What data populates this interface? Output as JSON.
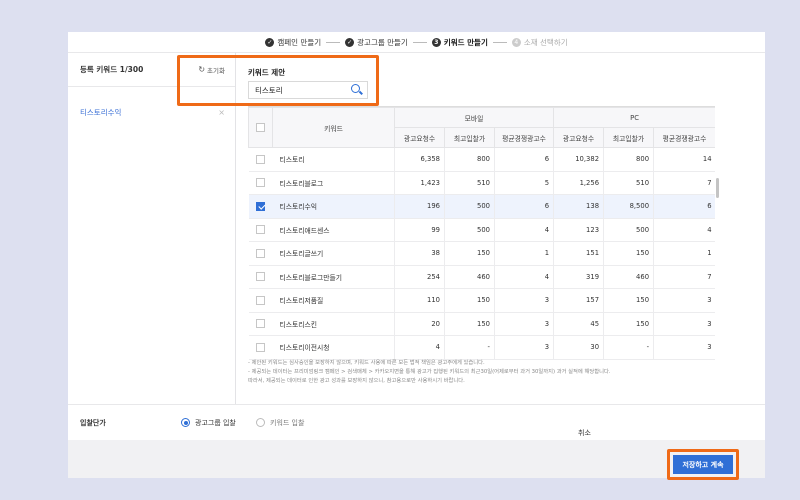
{
  "stepper": {
    "steps": [
      {
        "num": "✓",
        "label": "캠페인 만들기"
      },
      {
        "num": "✓",
        "label": "광고그룹 만들기"
      },
      {
        "num": "3",
        "label": "키워드 만들기"
      },
      {
        "num": "4",
        "label": "소재 선택하기"
      }
    ]
  },
  "left": {
    "title": "등록 키워드 1/300",
    "reset_label": "초기화",
    "items": [
      {
        "label": "티스토리수익",
        "remove": "×"
      }
    ]
  },
  "suggest": {
    "title": "키워드 제안",
    "search_value": "티스토리"
  },
  "table": {
    "col_keyword": "키워드",
    "group_mobile": "모바일",
    "group_pc": "PC",
    "sub_headers": [
      "광고요청수",
      "최고입찰가",
      "평균경쟁광고수",
      "광고요청수",
      "최고입찰가",
      "평균경쟁광고수"
    ],
    "rows": [
      {
        "checked": false,
        "keyword": "티스토리",
        "m_req": "6,358",
        "m_bid": "800",
        "m_comp": "6",
        "p_req": "10,382",
        "p_bid": "800",
        "p_comp": "14"
      },
      {
        "checked": false,
        "keyword": "티스토리블로그",
        "m_req": "1,423",
        "m_bid": "510",
        "m_comp": "5",
        "p_req": "1,256",
        "p_bid": "510",
        "p_comp": "7"
      },
      {
        "checked": true,
        "keyword": "티스토리수익",
        "m_req": "196",
        "m_bid": "500",
        "m_comp": "6",
        "p_req": "138",
        "p_bid": "8,500",
        "p_comp": "6"
      },
      {
        "checked": false,
        "keyword": "티스토리애드센스",
        "m_req": "99",
        "m_bid": "500",
        "m_comp": "4",
        "p_req": "123",
        "p_bid": "500",
        "p_comp": "4"
      },
      {
        "checked": false,
        "keyword": "티스토리글쓰기",
        "m_req": "38",
        "m_bid": "150",
        "m_comp": "1",
        "p_req": "151",
        "p_bid": "150",
        "p_comp": "1"
      },
      {
        "checked": false,
        "keyword": "티스토리블로그만들기",
        "m_req": "254",
        "m_bid": "460",
        "m_comp": "4",
        "p_req": "319",
        "p_bid": "460",
        "p_comp": "7"
      },
      {
        "checked": false,
        "keyword": "티스토리저품질",
        "m_req": "110",
        "m_bid": "150",
        "m_comp": "3",
        "p_req": "157",
        "p_bid": "150",
        "p_comp": "3"
      },
      {
        "checked": false,
        "keyword": "티스토리스킨",
        "m_req": "20",
        "m_bid": "150",
        "m_comp": "3",
        "p_req": "45",
        "p_bid": "150",
        "p_comp": "3"
      },
      {
        "checked": false,
        "keyword": "티스토리이전시청",
        "m_req": "4",
        "m_bid": "-",
        "m_comp": "3",
        "p_req": "30",
        "p_bid": "-",
        "p_comp": "3"
      }
    ]
  },
  "notes": [
    "- 제안된 키워드는 심사승인을 보장하지 않으며, 키워드 사용에 따른 모든 법적 책임은 광고주에게 있습니다.",
    "- 제공되는 데이터는 프리미엄링크 캠페인 > 검색매체 > 카카오지면을 통해 광고가 집행된 키워드의 최근30일(어제로부터 과거 30일까지) 과거 실적에 해당합니다.",
    "  따라서, 제공되는 데이터로 인한 광고 성과를 보장하지 않으니, 참고용으로만 사용하시기 바랍니다."
  ],
  "bid": {
    "label": "입찰단가",
    "option_adgroup": "광고그룹 입찰",
    "option_keyword": "키워드 입찰",
    "selected": "adgroup"
  },
  "footer": {
    "cancel_label": "취소",
    "save_label": "저장하고 계속"
  },
  "colors": {
    "accent": "#2f6fd6",
    "highlight": "#ef6a17"
  }
}
